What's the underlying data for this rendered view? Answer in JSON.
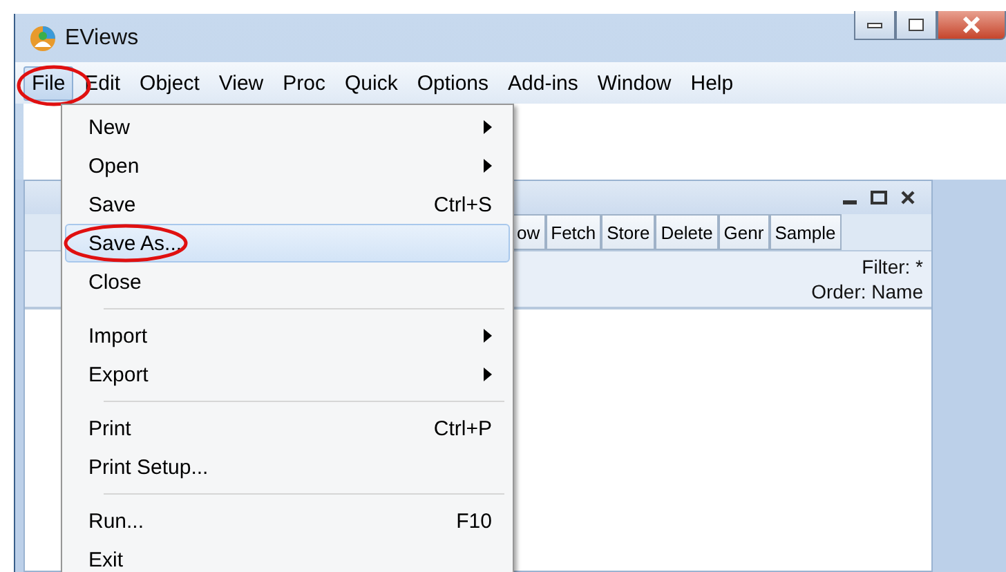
{
  "window": {
    "title": "EViews"
  },
  "menu_bar": [
    {
      "label": "File",
      "selected": true,
      "circled": true
    },
    {
      "label": "Edit",
      "selected": false,
      "circled": false
    },
    {
      "label": "Object",
      "selected": false,
      "circled": false
    },
    {
      "label": "View",
      "selected": false,
      "circled": false
    },
    {
      "label": "Proc",
      "selected": false,
      "circled": false
    },
    {
      "label": "Quick",
      "selected": false,
      "circled": false
    },
    {
      "label": "Options",
      "selected": false,
      "circled": false
    },
    {
      "label": "Add-ins",
      "selected": false,
      "circled": false
    },
    {
      "label": "Window",
      "selected": false,
      "circled": false
    },
    {
      "label": "Help",
      "selected": false,
      "circled": false
    }
  ],
  "file_menu": [
    {
      "kind": "item",
      "label": "New",
      "submenu": true,
      "selected": false,
      "circled": false
    },
    {
      "kind": "item",
      "label": "Open",
      "submenu": true,
      "selected": false,
      "circled": false
    },
    {
      "kind": "item",
      "label": "Save",
      "shortcut": "Ctrl+S",
      "submenu": false,
      "selected": false,
      "circled": false
    },
    {
      "kind": "item",
      "label": "Save As...",
      "submenu": false,
      "selected": true,
      "circled": true
    },
    {
      "kind": "item",
      "label": "Close",
      "submenu": false,
      "selected": false,
      "circled": false
    },
    {
      "kind": "separator"
    },
    {
      "kind": "item",
      "label": "Import",
      "submenu": true,
      "selected": false,
      "circled": false
    },
    {
      "kind": "item",
      "label": "Export",
      "submenu": true,
      "selected": false,
      "circled": false
    },
    {
      "kind": "separator"
    },
    {
      "kind": "item",
      "label": "Print",
      "shortcut": "Ctrl+P",
      "submenu": false,
      "selected": false,
      "circled": false
    },
    {
      "kind": "item",
      "label": "Print Setup...",
      "submenu": false,
      "selected": false,
      "circled": false
    },
    {
      "kind": "separator"
    },
    {
      "kind": "item",
      "label": "Run...",
      "shortcut": "F10",
      "submenu": false,
      "selected": false,
      "circled": false
    },
    {
      "kind": "item",
      "label": "Exit",
      "submenu": false,
      "selected": false,
      "circled": false
    }
  ],
  "workfile_window": {
    "toolbar": [
      "ow",
      "Fetch",
      "Store",
      "Delete",
      "Genr",
      "Sample"
    ],
    "filter": "Filter: *",
    "order": "Order: Name"
  }
}
